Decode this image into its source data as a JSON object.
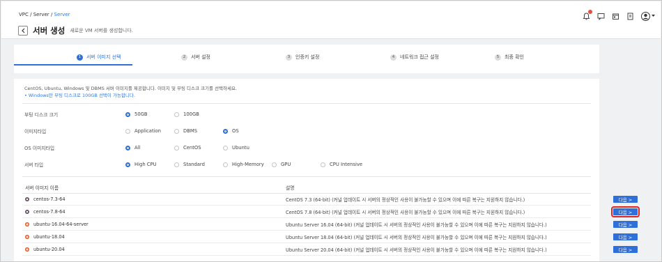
{
  "breadcrumb": {
    "items": [
      "VPC",
      "Server",
      "Server"
    ]
  },
  "header": {
    "title": "서버 생성",
    "subtitle": "새로운 VM 서버를 생성합니다."
  },
  "top_icons": [
    "notification-icon",
    "chat-icon",
    "calendar-icon",
    "document-icon",
    "user-avatar-icon",
    "caret-down-icon"
  ],
  "steps": [
    {
      "num": "1",
      "label": "서버 이미지 선택",
      "active": true
    },
    {
      "num": "2",
      "label": "서버 설정",
      "active": false
    },
    {
      "num": "3",
      "label": "인증키 설정",
      "active": false
    },
    {
      "num": "4",
      "label": "네트워크 접근 설정",
      "active": false
    },
    {
      "num": "5",
      "label": "최종 확인",
      "active": false
    }
  ],
  "info": {
    "text": "CentOS, Ubuntu, Windows 및 DBMS 서버 이미지를 제공합니다. 이미지 및 부팅 디스크 크기를 선택하세요.",
    "note": "• Windows만 부팅 디스크로 100GB 선택이 가능합니다."
  },
  "options": [
    {
      "label": "부팅 디스크 크기",
      "choices": [
        "50GB",
        "100GB"
      ],
      "selected": 0
    },
    {
      "label": "이미지타입",
      "choices": [
        "Application",
        "DBMS",
        "OS"
      ],
      "selected": 2
    },
    {
      "label": "OS 이미지타입",
      "choices": [
        "All",
        "CentOS",
        "Ubuntu"
      ],
      "selected": 0
    },
    {
      "label": "서버 타입",
      "choices": [
        "High CPU",
        "Standard",
        "High-Memory",
        "GPU",
        "CPU Intensive"
      ],
      "selected": 0
    }
  ],
  "table": {
    "headers": [
      "서버 이미지 이름",
      "설명"
    ],
    "rows": [
      {
        "name": "centos-7.3-64",
        "os": "centos",
        "desc": "CentOS 7.3 (64-bit) (커널 업데이트 시 서버의 정상적인 사용이 불가능할 수 있으며 이에 따른 복구는 지원하지 않습니다.)",
        "button": "다음 >"
      },
      {
        "name": "centos-7.8-64",
        "os": "centos",
        "desc": "CentOS 7.8 (64-bit) (커널 업데이트 시 서버의 정상적인 사용이 불가능할 수 있으며 이에 따른 복구는 지원하지 않습니다.)",
        "button": "다음 >"
      },
      {
        "name": "ubuntu-16.04-64-server",
        "os": "ubuntu",
        "desc": "Ubuntu Server 16.04 (64-bit) (커널 업데이트 시 서버의 정상적인 사용이 불가능할 수 있으며 이에 따른 복구는 지원하지 않습니다.)",
        "button": "다음 >"
      },
      {
        "name": "ubuntu-18.04",
        "os": "ubuntu",
        "desc": "Ubuntu Server 18.04 (64-bit) (커널 업데이트 시 서버의 정상적인 사용이 불가능할 수 있으며 이에 따른 복구는 지원하지 않습니다.)",
        "button": "다음 >"
      },
      {
        "name": "ubuntu-20.04",
        "os": "ubuntu",
        "desc": "Ubuntu Server 20.04 (64-bit) (커널 업데이트 시 서버의 정상적인 사용이 불가능할 수 있으며 이에 따른 복구는 지원하지 않습니다.)",
        "button": "다음 >"
      }
    ]
  },
  "colors": {
    "accent": "#2e6fd9",
    "highlight": "#e0231c",
    "link": "#3477d8"
  }
}
